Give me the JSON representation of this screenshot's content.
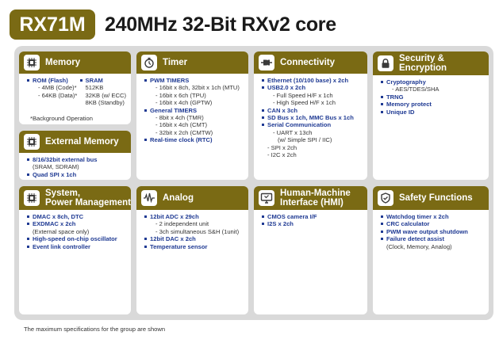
{
  "header": {
    "badge": "RX71M",
    "title": "240MHz 32-Bit RXv2 core"
  },
  "memory": {
    "title": "Memory",
    "icon": "chip-icon",
    "col1": {
      "label": "ROM (Flash)",
      "lines": [
        "- 4MB (Code)*",
        "- 64KB (Data)*"
      ]
    },
    "col2": {
      "label": "SRAM",
      "lines": [
        "512KB",
        "32KB (w/ ECC)",
        "8KB (Standby)"
      ]
    },
    "note": "*Background Operation"
  },
  "external_memory": {
    "title": "External Memory",
    "icon": "chip-icon",
    "items": [
      {
        "label": "8/16/32bit external bus",
        "sub": [
          "(SRAM, SDRAM)"
        ]
      },
      {
        "label": "Quad SPI x 1ch",
        "sub": []
      }
    ]
  },
  "timer": {
    "title": "Timer",
    "icon": "stopwatch-icon",
    "pwm": {
      "label": "PWM TIMERS",
      "lines": [
        "- 16bit x 8ch, 32bit x 1ch (MTU)",
        "- 16bit x 6ch (TPU)",
        "- 16bit x 4ch (GPTW)"
      ]
    },
    "general": {
      "label": "General TIMERS",
      "lines": [
        "- 8bit x 4ch (TMR)",
        "- 16bit x 4ch (CMT)",
        "- 32bit x 2ch (CMTW)"
      ]
    },
    "rtc": "Real-time clock (RTC)"
  },
  "connectivity": {
    "title": "Connectivity",
    "icon": "plug-icon",
    "ethernet": "Ethernet (10/100 base) x 2ch",
    "usb": {
      "label": "USB2.0 x 2ch",
      "lines": [
        "- Full Speed H/F x 1ch",
        "- High Speed H/F x 1ch"
      ]
    },
    "can": "CAN x 3ch",
    "sd": "SD Bus x 1ch, MMC Bus x 1ch",
    "serial": {
      "label": "Serial Communication",
      "lines": [
        "- UART x 13ch",
        "(w/ Simple SPI / IIC)"
      ],
      "plain": [
        "- SPI x 2ch",
        "- I2C x 2ch"
      ]
    }
  },
  "security": {
    "title_line1": "Security &",
    "title_line2": "Encryption",
    "icon": "lock-icon",
    "crypto": {
      "label": "Cryptography",
      "lines": [
        "- AES/TDES/SHA"
      ]
    },
    "items": [
      "TRNG",
      "Memory protect",
      "Unique ID"
    ]
  },
  "system": {
    "title_line1": "System,",
    "title_line2": "Power Management",
    "icon": "chip-icon",
    "dmac": "DMAC x 8ch, DTC",
    "exdmac": {
      "label": "EXDMAC x 2ch",
      "lines": [
        "(External space only)"
      ]
    },
    "items": [
      "High-speed on-chip oscillator",
      "Event link controller"
    ]
  },
  "analog": {
    "title": "Analog",
    "icon": "waveform-icon",
    "adc": {
      "label": "12bit  ADC x 29ch",
      "lines": [
        "- 2 independent unit",
        "- 3ch simultaneous S&H (1unit)"
      ]
    },
    "items": [
      "12bit DAC x 2ch",
      "Temperature sensor"
    ]
  },
  "hmi": {
    "title_line1": "Human-Machine",
    "title_line2": "Interface (HMI)",
    "icon": "monitor-icon",
    "items": [
      "CMOS camera I/F",
      "I2S x 2ch"
    ]
  },
  "safety": {
    "title": "Safety Functions",
    "icon": "shield-check-icon",
    "items": [
      "Watchdog timer x 2ch",
      "CRC calculator",
      "PWM wave output shutdown",
      "Failure detect assist"
    ],
    "detail": "(Clock, Memory, Analog)"
  },
  "footnote": "The maximum specifications for the group are shown",
  "colors": {
    "accent": "#7a6a14",
    "panel": "#d9d9d9",
    "item_text": "#1f3a93"
  }
}
